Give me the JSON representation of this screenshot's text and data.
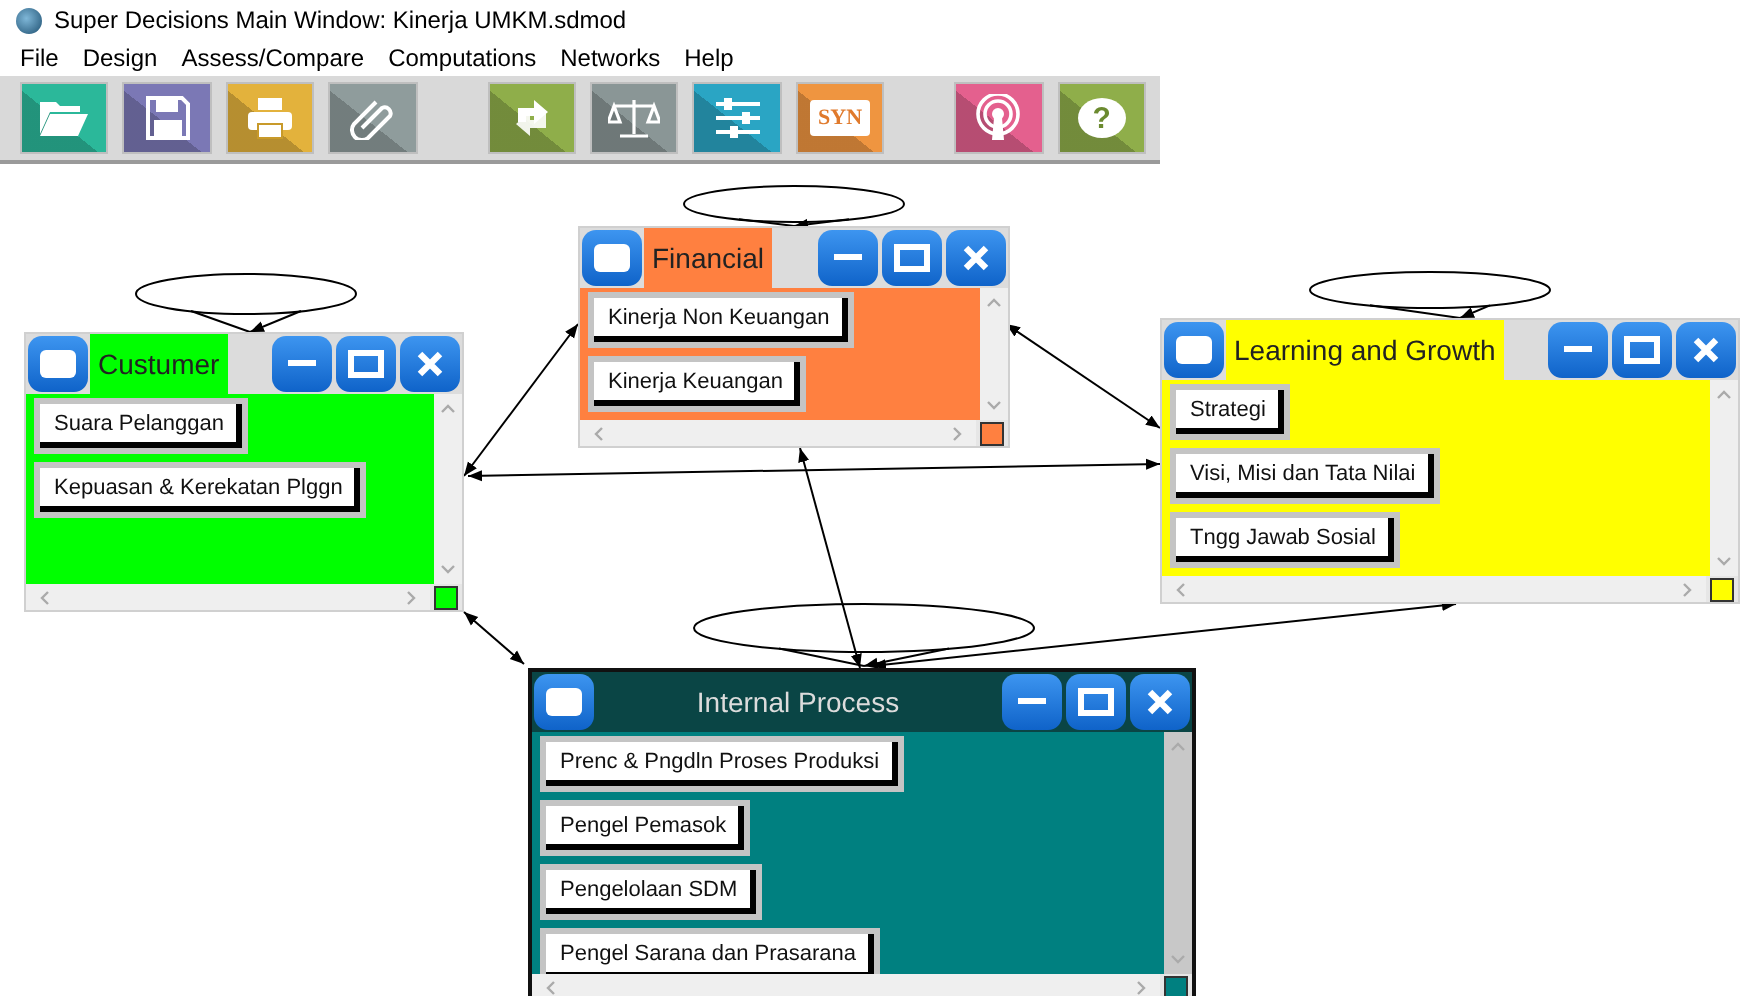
{
  "window": {
    "title": "Super Decisions Main Window: Kinerja UMKM.sdmod"
  },
  "menu": [
    "File",
    "Design",
    "Assess/Compare",
    "Computations",
    "Networks",
    "Help"
  ],
  "toolbar": [
    {
      "color": "#2bb89a"
    },
    {
      "color": "#7b78b5"
    },
    {
      "color": "#e3b23c"
    },
    {
      "color": "#8f9c9c"
    },
    {
      "color": "#8fae4a"
    },
    {
      "color": "#8a9696"
    },
    {
      "color": "#2aa5c4"
    },
    {
      "color": "#ef9540",
      "text": "SYN"
    },
    {
      "color": "#e4608e"
    },
    {
      "color": "#8fae4a",
      "text": "?"
    }
  ],
  "clusters": [
    {
      "name": "Financial",
      "color": "#ff8040",
      "selected": false,
      "nodes": [
        "Kinerja Non Keuangan",
        "Kinerja Keuangan"
      ]
    },
    {
      "name": "Custumer",
      "color": "#00ff00",
      "selected": false,
      "nodes": [
        "Suara Pelanggan",
        "Kepuasan & Kerekatan Plggn"
      ]
    },
    {
      "name": "Learning and Growth",
      "color": "#ffff00",
      "selected": false,
      "nodes": [
        "Strategi",
        "Visi, Misi dan Tata Nilai",
        "Tngg Jawab Sosial"
      ]
    },
    {
      "name": "Internal Process",
      "color": "#008080",
      "selected": true,
      "nodes": [
        "Prenc & Pngdln Proses Produksi",
        "Pengel Pemasok",
        "Pengelolaan SDM",
        "Pengel Sarana dan Prasarana"
      ]
    }
  ]
}
